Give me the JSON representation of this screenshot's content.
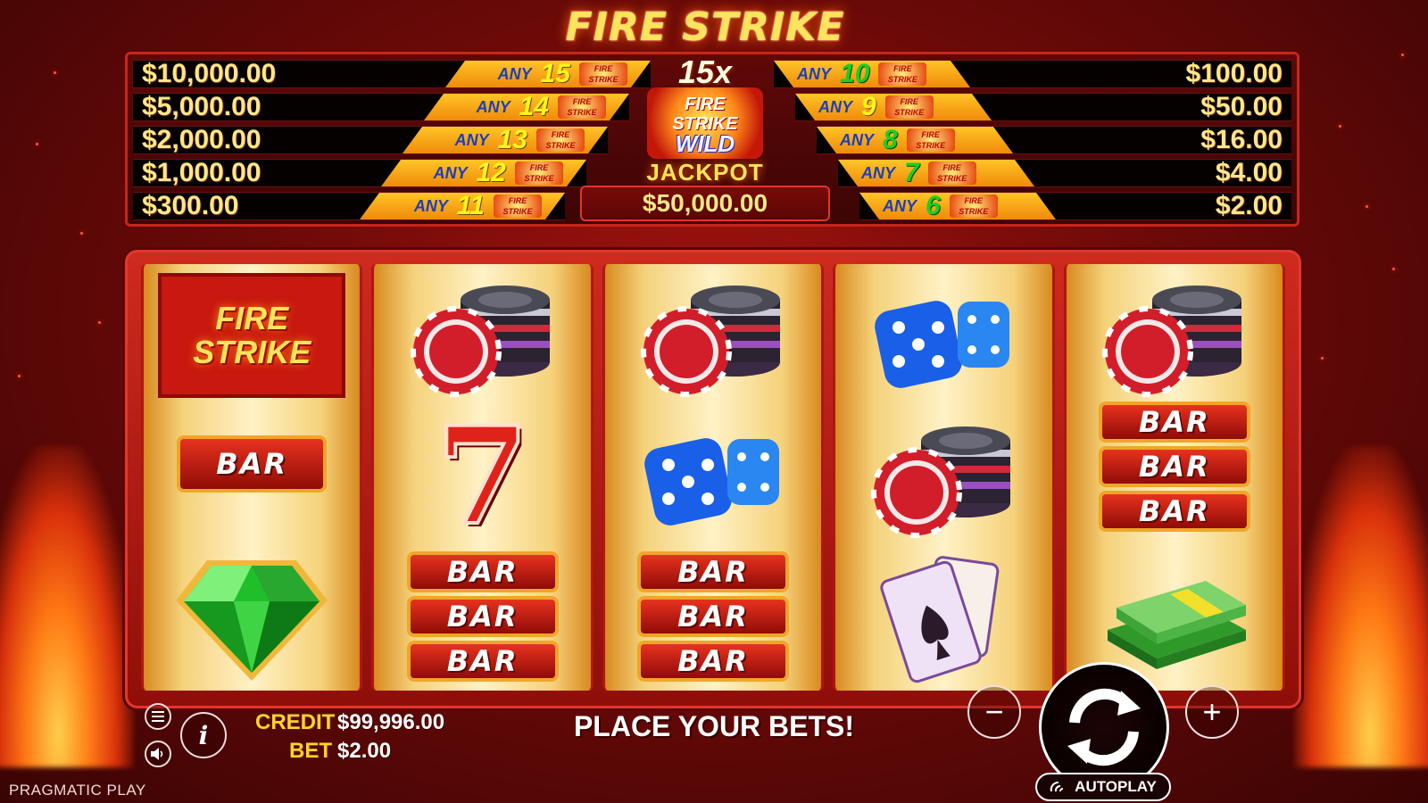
{
  "game": {
    "logo_line1": "FIRE",
    "logo_line2": "STRIKE",
    "logo_full": "FIRE STRIKE"
  },
  "paytable": {
    "any_label": "ANY",
    "left": [
      {
        "amount": "$10,000.00",
        "count": "15"
      },
      {
        "amount": "$5,000.00",
        "count": "14"
      },
      {
        "amount": "$2,000.00",
        "count": "13"
      },
      {
        "amount": "$1,000.00",
        "count": "12"
      },
      {
        "amount": "$300.00",
        "count": "11"
      }
    ],
    "right": [
      {
        "amount": "$100.00",
        "count": "10"
      },
      {
        "amount": "$50.00",
        "count": "9"
      },
      {
        "amount": "$16.00",
        "count": "8"
      },
      {
        "amount": "$4.00",
        "count": "7"
      },
      {
        "amount": "$2.00",
        "count": "6"
      }
    ],
    "mini_logo_text": "FIRE STRIKE"
  },
  "jackpot": {
    "multiplier": "15x",
    "wild_line1": "FIRE",
    "wild_line2": "STRIKE",
    "wild_line3": "WILD",
    "label": "JACKPOT",
    "value": "$50,000.00"
  },
  "reels": [
    [
      "fire-strike-logo",
      "bar",
      "green-diamond"
    ],
    [
      "casino-chips",
      "red-seven",
      "triple-bar"
    ],
    [
      "casino-chips",
      "blue-dice",
      "triple-bar"
    ],
    [
      "blue-dice",
      "casino-chips",
      "playing-cards"
    ],
    [
      "casino-chips",
      "triple-bar",
      "money-stack"
    ]
  ],
  "symbols": {
    "bar_text": "BAR",
    "seven_text": "7"
  },
  "controls": {
    "credit_label": "CREDIT",
    "credit_value": "$99,996.00",
    "bet_label": "BET",
    "bet_value": "$2.00",
    "message": "PLACE YOUR BETS!",
    "autoplay_label": "AUTOPLAY",
    "info_glyph": "i",
    "minus_glyph": "−",
    "plus_glyph": "+"
  },
  "brand": "PRAGMATIC PLAY",
  "colors": {
    "background": "#8f0e09",
    "accent_gold": "#ffc526",
    "jackpot_text": "#ffe68a",
    "count_green": "#1ccf21",
    "count_yellow": "#fff41a"
  }
}
